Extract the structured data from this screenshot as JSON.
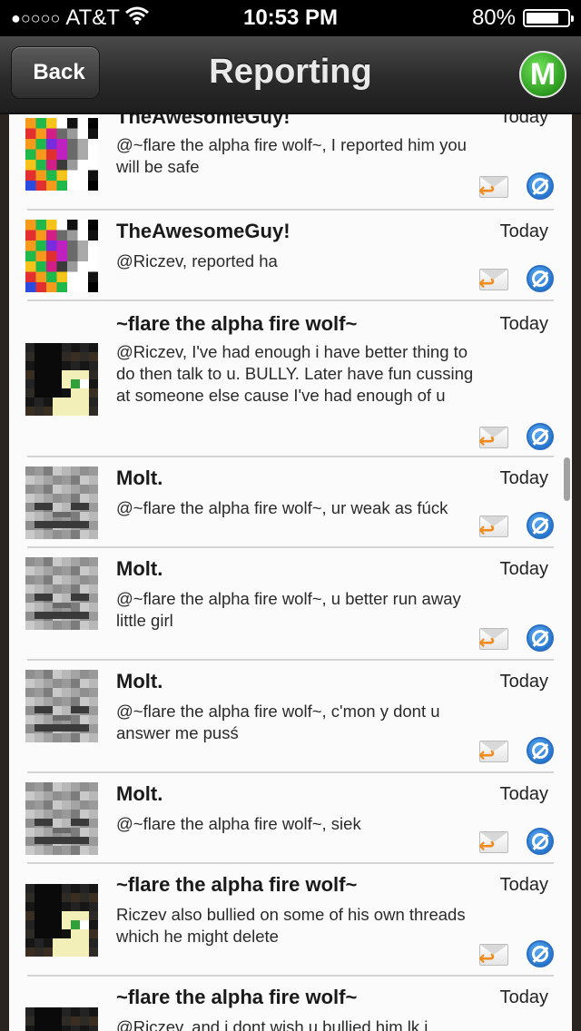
{
  "status_bar": {
    "signal": "●○○○○",
    "carrier": "AT&T",
    "time": "10:53 PM",
    "battery_percent": "80%",
    "battery_level": 0.8
  },
  "nav": {
    "back_label": "Back",
    "title": "Reporting",
    "logo_letter": "M"
  },
  "posts": [
    {
      "author": "TheAwesomeGuy!",
      "time": "Today",
      "message": "@~flare the alpha fire wolf~, I reported him you will be safe",
      "avatar": "rainbow"
    },
    {
      "author": "TheAwesomeGuy!",
      "time": "Today",
      "message": "@Riczev, reported ha",
      "avatar": "rainbow"
    },
    {
      "author": "~flare the alpha fire wolf~",
      "time": "Today",
      "message": "@Riczev, I've had enough i have better thing to do then talk to u. BULLY. Later have fun cussing at someone else cause I've had enough of u",
      "avatar": "wolf"
    },
    {
      "author": "Molt.",
      "time": "Today",
      "message": "@~flare the alpha fire wolf~, ur weak as fúck",
      "avatar": "skeleton"
    },
    {
      "author": "Molt.",
      "time": "Today",
      "message": "@~flare the alpha fire wolf~, u better run away little girl",
      "avatar": "skeleton"
    },
    {
      "author": "Molt.",
      "time": "Today",
      "message": "@~flare the alpha fire wolf~, c'mon y dont u answer me pusś",
      "avatar": "skeleton"
    },
    {
      "author": "Molt.",
      "time": "Today",
      "message": "@~flare the alpha fire wolf~, siek",
      "avatar": "skeleton"
    },
    {
      "author": "~flare the alpha fire wolf~",
      "time": "Today",
      "message": "Riczev also bullied on some of his own threads which he might delete",
      "avatar": "wolf"
    },
    {
      "author": "~flare the alpha fire wolf~",
      "time": "Today",
      "message": "@Riczev, and i dont wish u bullied him lk i",
      "avatar": "wolf"
    }
  ]
}
